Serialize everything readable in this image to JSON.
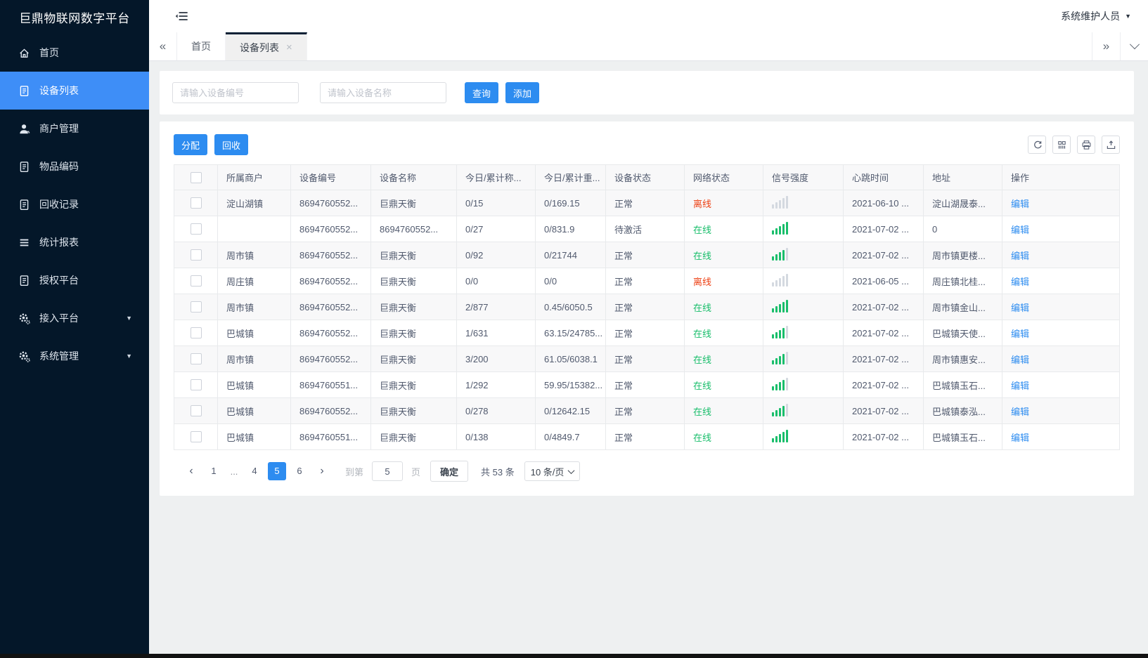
{
  "colors": {
    "accent": "#2d8cf0",
    "sidebar_bg": "#041729",
    "active_item": "#3e8ef7",
    "online": "#19be6b",
    "offline": "#ed4014"
  },
  "sidebar": {
    "title": "巨鼎物联网数字平台",
    "items": [
      {
        "label": "首页",
        "icon": "home-icon"
      },
      {
        "label": "设备列表",
        "icon": "device-list-icon",
        "active": true
      },
      {
        "label": "商户管理",
        "icon": "merchant-icon"
      },
      {
        "label": "物品编码",
        "icon": "item-code-icon"
      },
      {
        "label": "回收记录",
        "icon": "recycle-record-icon"
      },
      {
        "label": "统计报表",
        "icon": "report-icon"
      },
      {
        "label": "授权平台",
        "icon": "auth-platform-icon"
      },
      {
        "label": "接入平台",
        "icon": "access-platform-icon",
        "expandable": true
      },
      {
        "label": "系统管理",
        "icon": "system-mgmt-icon",
        "expandable": true
      }
    ]
  },
  "header": {
    "user": "系统维护人员"
  },
  "tabs": {
    "home": "首页",
    "device_list": "设备列表"
  },
  "search": {
    "device_no_placeholder": "请输入设备编号",
    "device_name_placeholder": "请输入设备名称",
    "query_label": "查询",
    "add_label": "添加"
  },
  "toolbar": {
    "assign_label": "分配",
    "recycle_label": "回收"
  },
  "table": {
    "columns": [
      "所属商户",
      "设备编号",
      "设备名称",
      "今日/累计称...",
      "今日/累计重...",
      "设备状态",
      "网络状态",
      "信号强度",
      "心跳时间",
      "地址",
      "操作"
    ],
    "rows": [
      {
        "merchant": "淀山湖镇",
        "device_no": "8694760552...",
        "device_name": "巨鼎天衡",
        "today_count": "0/15",
        "today_weight": "0/169.15",
        "device_status": "正常",
        "network_status": "离线",
        "network_color": "red",
        "signal": 0,
        "heartbeat": "2021-06-10 ...",
        "address": "淀山湖晟泰...",
        "action": "编辑"
      },
      {
        "merchant": "",
        "device_no": "8694760552...",
        "device_name": "8694760552...",
        "today_count": "0/27",
        "today_weight": "0/831.9",
        "device_status": "待激活",
        "network_status": "在线",
        "network_color": "green",
        "signal": 5,
        "heartbeat": "2021-07-02 ...",
        "address": "0",
        "action": "编辑"
      },
      {
        "merchant": "周市镇",
        "device_no": "8694760552...",
        "device_name": "巨鼎天衡",
        "today_count": "0/92",
        "today_weight": "0/21744",
        "device_status": "正常",
        "network_status": "在线",
        "network_color": "green",
        "signal": 4,
        "heartbeat": "2021-07-02 ...",
        "address": "周市镇更楼...",
        "action": "编辑"
      },
      {
        "merchant": "周庄镇",
        "device_no": "8694760552...",
        "device_name": "巨鼎天衡",
        "today_count": "0/0",
        "today_weight": "0/0",
        "device_status": "正常",
        "network_status": "离线",
        "network_color": "red",
        "signal": 0,
        "heartbeat": "2021-06-05 ...",
        "address": "周庄镇北桂...",
        "action": "编辑"
      },
      {
        "merchant": "周市镇",
        "device_no": "8694760552...",
        "device_name": "巨鼎天衡",
        "today_count": "2/877",
        "today_weight": "0.45/6050.5",
        "device_status": "正常",
        "network_status": "在线",
        "network_color": "green",
        "signal": 5,
        "heartbeat": "2021-07-02 ...",
        "address": "周市镇金山...",
        "action": "编辑"
      },
      {
        "merchant": "巴城镇",
        "device_no": "8694760552...",
        "device_name": "巨鼎天衡",
        "today_count": "1/631",
        "today_weight": "63.15/24785...",
        "device_status": "正常",
        "network_status": "在线",
        "network_color": "green",
        "signal": 4,
        "heartbeat": "2021-07-02 ...",
        "address": "巴城镇天使...",
        "action": "编辑"
      },
      {
        "merchant": "周市镇",
        "device_no": "8694760552...",
        "device_name": "巨鼎天衡",
        "today_count": "3/200",
        "today_weight": "61.05/6038.1",
        "device_status": "正常",
        "network_status": "在线",
        "network_color": "green",
        "signal": 4,
        "heartbeat": "2021-07-02 ...",
        "address": "周市镇惠安...",
        "action": "编辑"
      },
      {
        "merchant": "巴城镇",
        "device_no": "8694760551...",
        "device_name": "巨鼎天衡",
        "today_count": "1/292",
        "today_weight": "59.95/15382...",
        "device_status": "正常",
        "network_status": "在线",
        "network_color": "green",
        "signal": 4,
        "heartbeat": "2021-07-02 ...",
        "address": "巴城镇玉石...",
        "action": "编辑"
      },
      {
        "merchant": "巴城镇",
        "device_no": "8694760552...",
        "device_name": "巨鼎天衡",
        "today_count": "0/278",
        "today_weight": "0/12642.15",
        "device_status": "正常",
        "network_status": "在线",
        "network_color": "green",
        "signal": 4,
        "heartbeat": "2021-07-02 ...",
        "address": "巴城镇泰泓...",
        "action": "编辑"
      },
      {
        "merchant": "巴城镇",
        "device_no": "8694760551...",
        "device_name": "巨鼎天衡",
        "today_count": "0/138",
        "today_weight": "0/4849.7",
        "device_status": "正常",
        "network_status": "在线",
        "network_color": "green",
        "signal": 5,
        "heartbeat": "2021-07-02 ...",
        "address": "巴城镇玉石...",
        "action": "编辑"
      }
    ]
  },
  "pagination": {
    "pages": [
      "1",
      "...",
      "4",
      "5",
      "6"
    ],
    "active_page": "5",
    "goto_label": "到第",
    "goto_value": "5",
    "page_label": "页",
    "confirm_label": "确定",
    "total_label": "共 53 条",
    "page_size": "10 条/页"
  }
}
